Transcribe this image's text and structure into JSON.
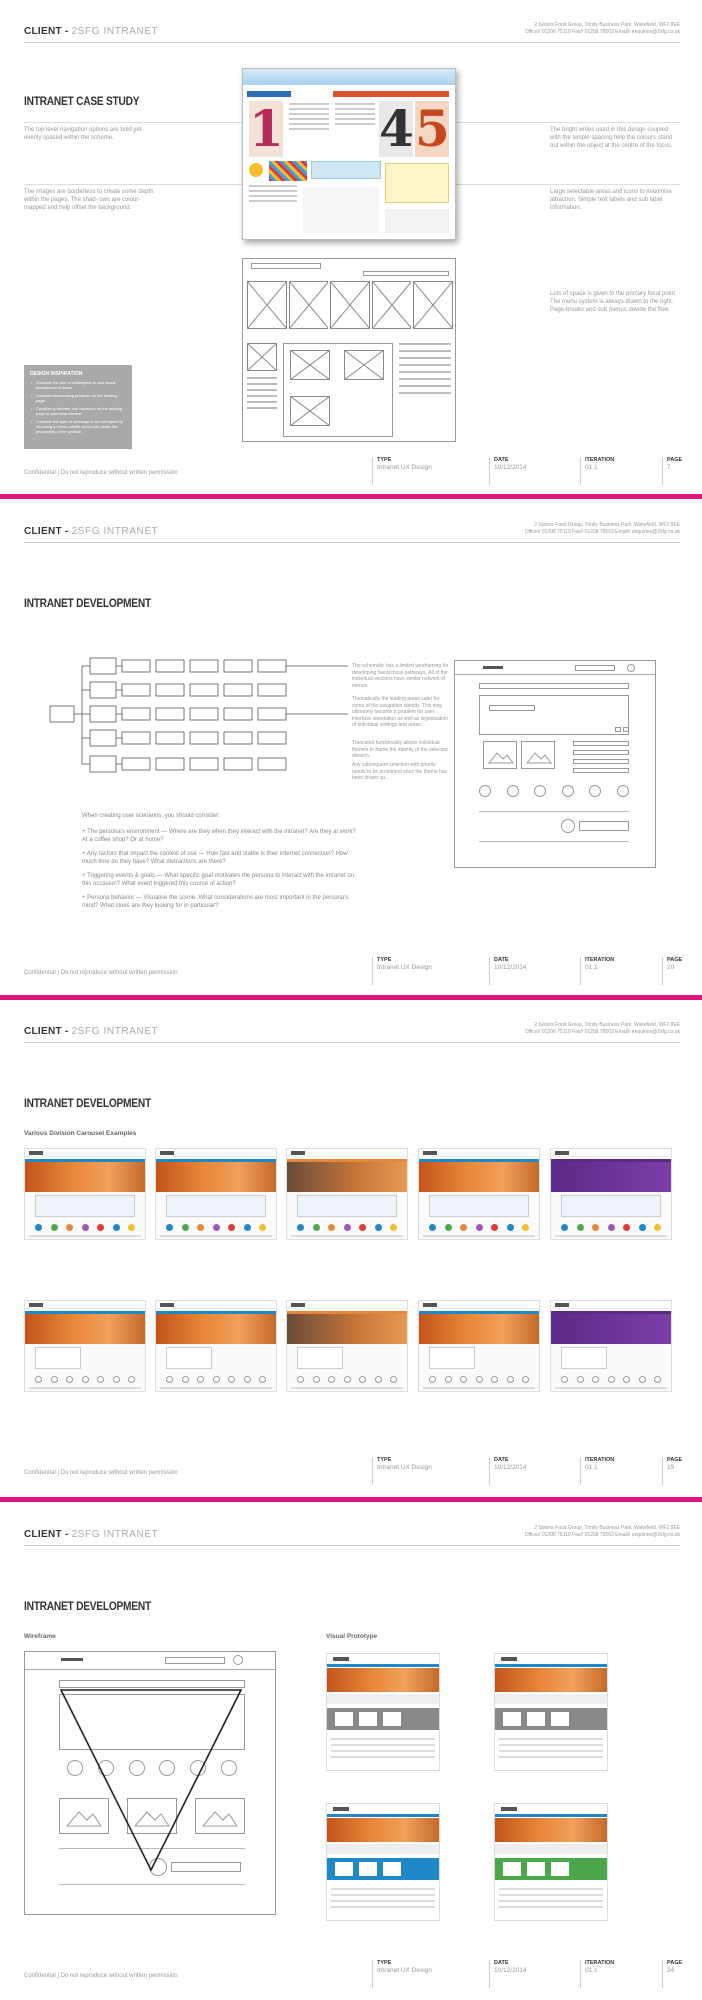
{
  "header": {
    "client_label": "CLIENT -",
    "project": "2SFG INTRANET",
    "address_line1": "2 Sisters Food Group, Trinity Business Park, Wakefield, WF2 8EE",
    "address_line2": "Office// 01208 75110 Fax// 01208 79563 Email// enquiries@2sfg.co.uk"
  },
  "footer": {
    "confidential": "Confidential  |  Do not reproduce without written permission",
    "type_label": "TYPE",
    "type_value": "Intranet UX Design",
    "date_label": "DATE",
    "date_value": "10/12/2014",
    "iteration_label": "ITERATION",
    "iteration_value": "01.1",
    "page_label": "PAGE"
  },
  "pages": [
    {
      "title": "INTRANET CASE STUDY",
      "page_number": "7",
      "notes": {
        "left_top": "The top level navigation options are bold yet evenly spaced within the scheme.",
        "left_bottom": "The images are borderless to create some depth within the pages. The shad- ows are colour-mapped and help offset the background.",
        "right_top": "The bright writes used in this design coupled with the simple spacing help the colours stand out within the object at the centre of the focus.",
        "right_middle": "Large selectable areas and icons to maximise attraction. Simple text labels and sub label information.",
        "right_bottom": "Lots of space is given to the primary focal point. The menu system is always drawn to the right. Page-breaks and sub menus devide the flow."
      },
      "inspiration": {
        "title": "DESIGN INSPIRATION",
        "items": [
          "Consider the use of whitespace to add visual prominence to items.",
          "Consider showcasing products on the landing page.",
          "Consider a discrete and balanced on the landing page to add extra interest.",
          "Consider the type of message to be conveyed by choosing a colour palette which will create the personality of the website."
        ]
      },
      "hero_numbers": [
        "1",
        "4",
        "5"
      ]
    },
    {
      "title": "INTRANET DEVELOPMENT",
      "page_number": "20",
      "schematic_notes": [
        "The schematic has a limited wireframing for developing hierarchical pathways. All of the individual sections have similar network of menus.",
        "Thematically the leading areas cater for some of the navigation identity. This may ultimately become a problem for user interface orientation as well as organisation of individual settings and areas.",
        "Truncated functionality allows individual themes to frame the identity of the selected division.",
        "Any subsequent selection with priority needs to be prominent once the theme has been drawn up."
      ],
      "scenario_intro": "When creating user scenarios, you should consider:",
      "scenario_items": [
        "+ The persona's environment — Where are they when they interact with the intranet? Are they at work? At a coffee shop? Or at home?",
        "+ Any factors that impact the context of use — How fast and stable is their internet connection? How much time do they have? What distractions are there?",
        "+ Triggering events & goals — What specific goal motivates the persona to interact with the intranet on this occasion? What event triggered this course of action?",
        "+ Persona behavior — Visualise the scene. What considerations are most important in the persona's mind? What clues are they looking for in particular?"
      ]
    },
    {
      "title": "INTRANET DEVELOPMENT",
      "page_number": "19",
      "subtitle": "Various Division Carousel Examples"
    },
    {
      "title": "INTRANET DEVELOPMENT",
      "page_number": "24",
      "left_label": "Wireframe",
      "right_label": "Visual Prototype"
    }
  ],
  "colors": {
    "accent": "#e0157f",
    "orange": "#e8873a",
    "purple": "#5a2a86",
    "blue": "#1e88c8",
    "green": "#4aa84a"
  }
}
